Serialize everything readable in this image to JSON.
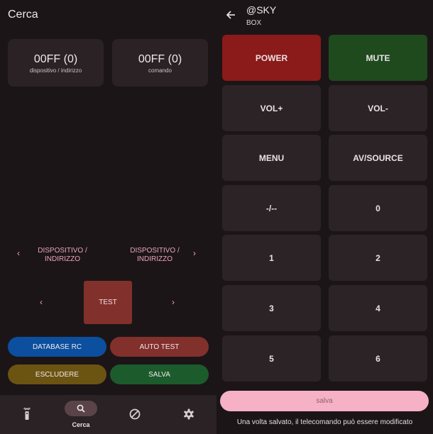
{
  "search": {
    "title": "Cerca",
    "cards": [
      {
        "value": "00FF (0)",
        "label": "dispositivo / indirizzo"
      },
      {
        "value": "00FF (0)",
        "label": "comando"
      }
    ],
    "nav_left_label_line1": "DISPOSITIVO /",
    "nav_left_label_line2": "INDIRIZZO",
    "nav_right_label_line1": "DISPOSITIVO /",
    "nav_right_label_line2": "INDIRIZZO",
    "arrow_prev": "‹",
    "arrow_next": "›",
    "test_label": "TEST",
    "buttons": {
      "database": {
        "label": "DATABASE RC",
        "color": "#0b4f9e"
      },
      "autotest": {
        "label": "AUTO TEST",
        "color": "#82302c"
      },
      "exclude": {
        "label": "ESCLUDERE",
        "color": "#6b5312"
      },
      "save": {
        "label": "SALVA",
        "color": "#1c5b2c"
      }
    },
    "bottom_nav": {
      "active_label": "Cerca",
      "icons": [
        "remote-icon",
        "search-icon",
        "block-icon",
        "settings-icon"
      ]
    }
  },
  "remote": {
    "title": "@SKY",
    "subtitle": "BOX",
    "keys": [
      {
        "label": "POWER",
        "color": "#8b1a1a"
      },
      {
        "label": "MUTE",
        "color": "#1e4a1e"
      },
      {
        "label": "VOL+",
        "color": "#2c2326"
      },
      {
        "label": "VOL-",
        "color": "#2c2326"
      },
      {
        "label": "MENU",
        "color": "#2c2326"
      },
      {
        "label": "AV/SOURCE",
        "color": "#2c2326"
      },
      {
        "label": "-/--",
        "color": "#2c2326"
      },
      {
        "label": "0",
        "color": "#2c2326"
      },
      {
        "label": "1",
        "color": "#2c2326"
      },
      {
        "label": "2",
        "color": "#2c2326"
      },
      {
        "label": "3",
        "color": "#2c2326"
      },
      {
        "label": "4",
        "color": "#2c2326"
      },
      {
        "label": "5",
        "color": "#2c2326"
      },
      {
        "label": "6",
        "color": "#2c2326"
      }
    ],
    "save_label": "salva",
    "note": "Una volta salvato, il telecomando può essere modificato"
  }
}
